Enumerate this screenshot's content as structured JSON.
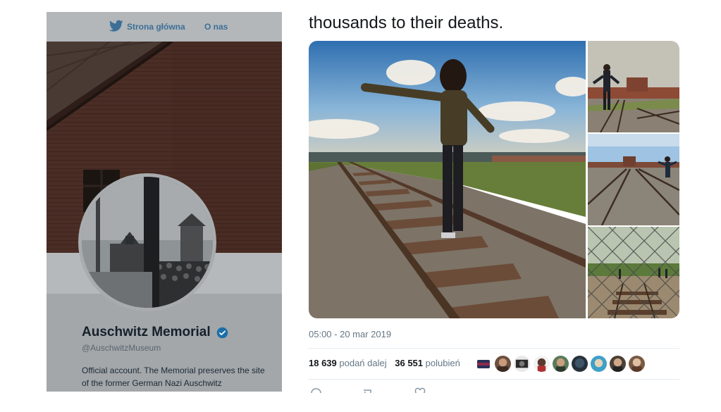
{
  "nav": {
    "home_label": "Strona główna",
    "about_label": "O nas"
  },
  "profile": {
    "name": "Auschwitz Memorial",
    "handle": "@AuschwitzMuseum",
    "bio": "Official account. The Memorial preserves the site of the former German Nazi Auschwitz",
    "verified": true
  },
  "tweet": {
    "text": "thousands to their deaths.",
    "timestamp": "05:00 - 20 mar 2019",
    "stats": {
      "retweets_count": "18 639",
      "retweets_label": "podań dalej",
      "likes_count": "36 551",
      "likes_label": "polubień"
    },
    "photos": [
      {
        "name": "girl-balancing-on-rail-photo"
      },
      {
        "name": "man-walking-on-tracks-photo"
      },
      {
        "name": "woman-on-tracks-photo"
      },
      {
        "name": "fence-and-tracks-photo"
      }
    ],
    "likers_count_shown": 9
  },
  "colors": {
    "link": "#3c6f97",
    "verified": "#1da1f2",
    "muted_text": "#657786",
    "divider": "#e6ecf0"
  },
  "icons": [
    "twitter-bird-icon",
    "verified-badge-icon",
    "reply-icon",
    "retweet-icon",
    "like-icon"
  ]
}
